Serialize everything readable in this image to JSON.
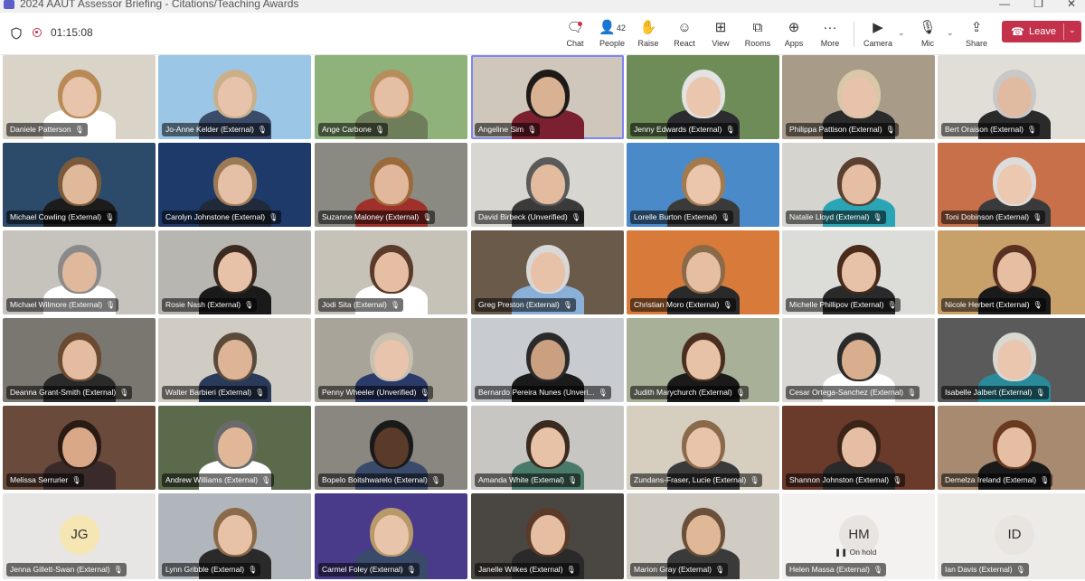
{
  "window": {
    "title": "2024 AAUT Assessor Briefing - Citations/Teaching Awards",
    "controls": [
      "—",
      "❐",
      "✕"
    ]
  },
  "meeting": {
    "elapsed": "01:15:08",
    "accent": "#5b5fc7",
    "leave_color": "#c4314b"
  },
  "toolbar": {
    "chat": "Chat",
    "people": "People",
    "people_count": "42",
    "raise": "Raise",
    "react": "React",
    "view": "View",
    "rooms": "Rooms",
    "apps": "Apps",
    "more": "More",
    "camera": "Camera",
    "mic": "Mic",
    "share": "Share",
    "leave": "Leave"
  },
  "tiles": [
    {
      "name": "Daniele Patterson",
      "bg": "#d9d3c8",
      "skin": "#e8c4ad",
      "hair": "#b98a55",
      "shirt": "#ffffff"
    },
    {
      "name": "Jo-Anne Kelder (External)",
      "bg": "#9cc6e6",
      "skin": "#e7c3ab",
      "hair": "#c9b08a",
      "shirt": "#3b4b6a"
    },
    {
      "name": "Ange Carbone",
      "bg": "#8fb27a",
      "skin": "#e5bfa3",
      "hair": "#b88d5e",
      "shirt": "#6e7d5a"
    },
    {
      "name": "Angeline Sim",
      "bg": "#cfc7bb",
      "skin": "#d9b193",
      "hair": "#1e1a18",
      "shirt": "#7a2030",
      "active": true
    },
    {
      "name": "Jenny Edwards (External)",
      "bg": "#6e8c58",
      "skin": "#eac6ae",
      "hair": "#e3e3e3",
      "shirt": "#2c2c30"
    },
    {
      "name": "Philippa Pattison (External)",
      "bg": "#a89c88",
      "skin": "#e8c2aa",
      "hair": "#d8c8a8",
      "shirt": "#2b2b2b"
    },
    {
      "name": "Bert Oraison (External)",
      "bg": "#e1ded8",
      "skin": "#e0bba2",
      "hair": "#c8c8c8",
      "shirt": "#2a2a2a"
    },
    {
      "name": "Michael Cowling (External)",
      "bg": "#2c4a6a",
      "skin": "#e0b89a",
      "hair": "#7a5a3a",
      "shirt": "#1c1c1c"
    },
    {
      "name": "Carolyn Johnstone (External)",
      "bg": "#1d3a6a",
      "skin": "#e5c0a6",
      "hair": "#9c7a56",
      "shirt": "#202a3a"
    },
    {
      "name": "Suzanne Maloney (External)",
      "bg": "#8a8a82",
      "skin": "#e2b89c",
      "hair": "#9a6a3a",
      "shirt": "#a0302a"
    },
    {
      "name": "David Birbeck (Unverified)",
      "bg": "#d8d6d0",
      "skin": "#e3bca0",
      "hair": "#5a5a5a",
      "shirt": "#3a3a3a"
    },
    {
      "name": "Lorelle Burton (External)",
      "bg": "#4a8ac8",
      "skin": "#ebc5ac",
      "hair": "#a27a4e",
      "shirt": "#3a3a3a"
    },
    {
      "name": "Natalie Lloyd (External)",
      "bg": "#d6d4ce",
      "skin": "#e6bea4",
      "hair": "#5a4030",
      "shirt": "#2aa5b5"
    },
    {
      "name": "Toni Dobinson (External)",
      "bg": "#c8704a",
      "skin": "#ecc8b0",
      "hair": "#dcdcdc",
      "shirt": "#3a3a3a"
    },
    {
      "name": "Michael Wilmore (External)",
      "bg": "#c6c2bc",
      "skin": "#e0b89c",
      "hair": "#8a8a8a",
      "shirt": "#ffffff"
    },
    {
      "name": "Rosie Nash (External)",
      "bg": "#b8b6b0",
      "skin": "#e8c2a8",
      "hair": "#3a2a20",
      "shirt": "#1a1a1a"
    },
    {
      "name": "Jodi Sita (External)",
      "bg": "#c6c2b8",
      "skin": "#e6bea4",
      "hair": "#5a3a28",
      "shirt": "#ffffff"
    },
    {
      "name": "Greg Preston (External)",
      "bg": "#6a5a4a",
      "skin": "#e8c2a8",
      "hair": "#d8d8d8",
      "shirt": "#8ab0d8"
    },
    {
      "name": "Christian Moro (External)",
      "bg": "#d87a3a",
      "skin": "#e6bea2",
      "hair": "#8a6a48",
      "shirt": "#2a2a2a"
    },
    {
      "name": "Michelle Phillipov (External)",
      "bg": "#dcdcd8",
      "skin": "#e8c2a8",
      "hair": "#4a2a1a",
      "shirt": "#2a2a2a"
    },
    {
      "name": "Nicole Herbert (External)",
      "bg": "#c8a06a",
      "skin": "#e6bea2",
      "hair": "#5a3020",
      "shirt": "#1a1a1a"
    },
    {
      "name": "Deanna Grant-Smith (External)",
      "bg": "#7a7670",
      "skin": "#e4bca2",
      "hair": "#6a4a30",
      "shirt": "#2a2a2a"
    },
    {
      "name": "Walter Barbieri (External)",
      "bg": "#d0ccc4",
      "skin": "#deb496",
      "hair": "#5a4a3a",
      "shirt": "#2a3a5a"
    },
    {
      "name": "Penny Wheeler (Unverified)",
      "bg": "#a8a49a",
      "skin": "#e8c4ac",
      "hair": "#c8c0b0",
      "shirt": "#2a3a6a"
    },
    {
      "name": "Bernardo Pereira Nunes (Unveri...",
      "bg": "#c8ccd0",
      "skin": "#caa080",
      "hair": "#2a2a2a",
      "shirt": "#1a1a1a"
    },
    {
      "name": "Judith Marychurch (External)",
      "bg": "#a8b098",
      "skin": "#e8c2a6",
      "hair": "#4a2e20",
      "shirt": "#1a1a1a"
    },
    {
      "name": "Cesar Ortega-Sanchez (External)",
      "bg": "#d8d6d2",
      "skin": "#d8ae8e",
      "hair": "#2a2a2a",
      "shirt": "#ffffff"
    },
    {
      "name": "Isabelle Jalbert (External)",
      "bg": "#5a5a5a",
      "skin": "#eac6ae",
      "hair": "#d8d8d0",
      "shirt": "#2a8a9a"
    },
    {
      "name": "Melissa Serrurier",
      "bg": "#6a4a3a",
      "skin": "#d8a888",
      "hair": "#2a1a14",
      "shirt": "#3a2a2a"
    },
    {
      "name": "Andrew Williams (External)",
      "bg": "#5a6a4a",
      "skin": "#e0b898",
      "hair": "#6a6a6a",
      "shirt": "#ffffff"
    },
    {
      "name": "Bopelo Boitshwarelo (External)",
      "bg": "#8a8680",
      "skin": "#5a3a28",
      "hair": "#1a1a1a",
      "shirt": "#3a4a6a"
    },
    {
      "name": "Amanda White (External)",
      "bg": "#c8c6c2",
      "skin": "#e8c2a6",
      "hair": "#3a2a20",
      "shirt": "#4a7a6a"
    },
    {
      "name": "Zundans-Fraser, Lucie (External)",
      "bg": "#d6cfc0",
      "skin": "#e8c4aa",
      "hair": "#8a6a4a",
      "shirt": "#3a3a3a"
    },
    {
      "name": "Shannon Johnston (External)",
      "bg": "#6a3a2a",
      "skin": "#e6bea4",
      "hair": "#3a2418",
      "shirt": "#2a2a2a"
    },
    {
      "name": "Demelza Ireland (External)",
      "bg": "#a88a70",
      "skin": "#e6bea4",
      "hair": "#6a3a20",
      "shirt": "#1a1a1a"
    },
    {
      "name": "Jenna Gillett-Swan (External)",
      "bg": "#e8e6e4",
      "avatar": "JG",
      "avatar_bg": "#f6e6b4"
    },
    {
      "name": "Lynn Gribble (External)",
      "bg": "#b0b6bc",
      "skin": "#e8c2a6",
      "hair": "#8a6a48",
      "shirt": "#2a2a2a"
    },
    {
      "name": "Carmel Foley (External)",
      "bg": "#4a3a8a",
      "skin": "#e8c4aa",
      "hair": "#b89a6a",
      "shirt": "#3a4a6a"
    },
    {
      "name": "Janelle Wilkes (External)",
      "bg": "#4a4642",
      "skin": "#e6bea2",
      "hair": "#5a3a28",
      "shirt": "#2a2a2a"
    },
    {
      "name": "Marion Gray (External)",
      "bg": "#d0ccc4",
      "skin": "#e0b898",
      "hair": "#6a5038",
      "shirt": "#3a3a3a"
    },
    {
      "name": "Helen Massa (External)",
      "bg": "#f4f2f0",
      "avatar": "HM",
      "avatar_bg": "#e8e4e0",
      "status": "On hold"
    },
    {
      "name": "Ian Davis (External)",
      "bg": "#ecebe8",
      "avatar": "ID",
      "avatar_bg": "#e8e4e0"
    }
  ]
}
